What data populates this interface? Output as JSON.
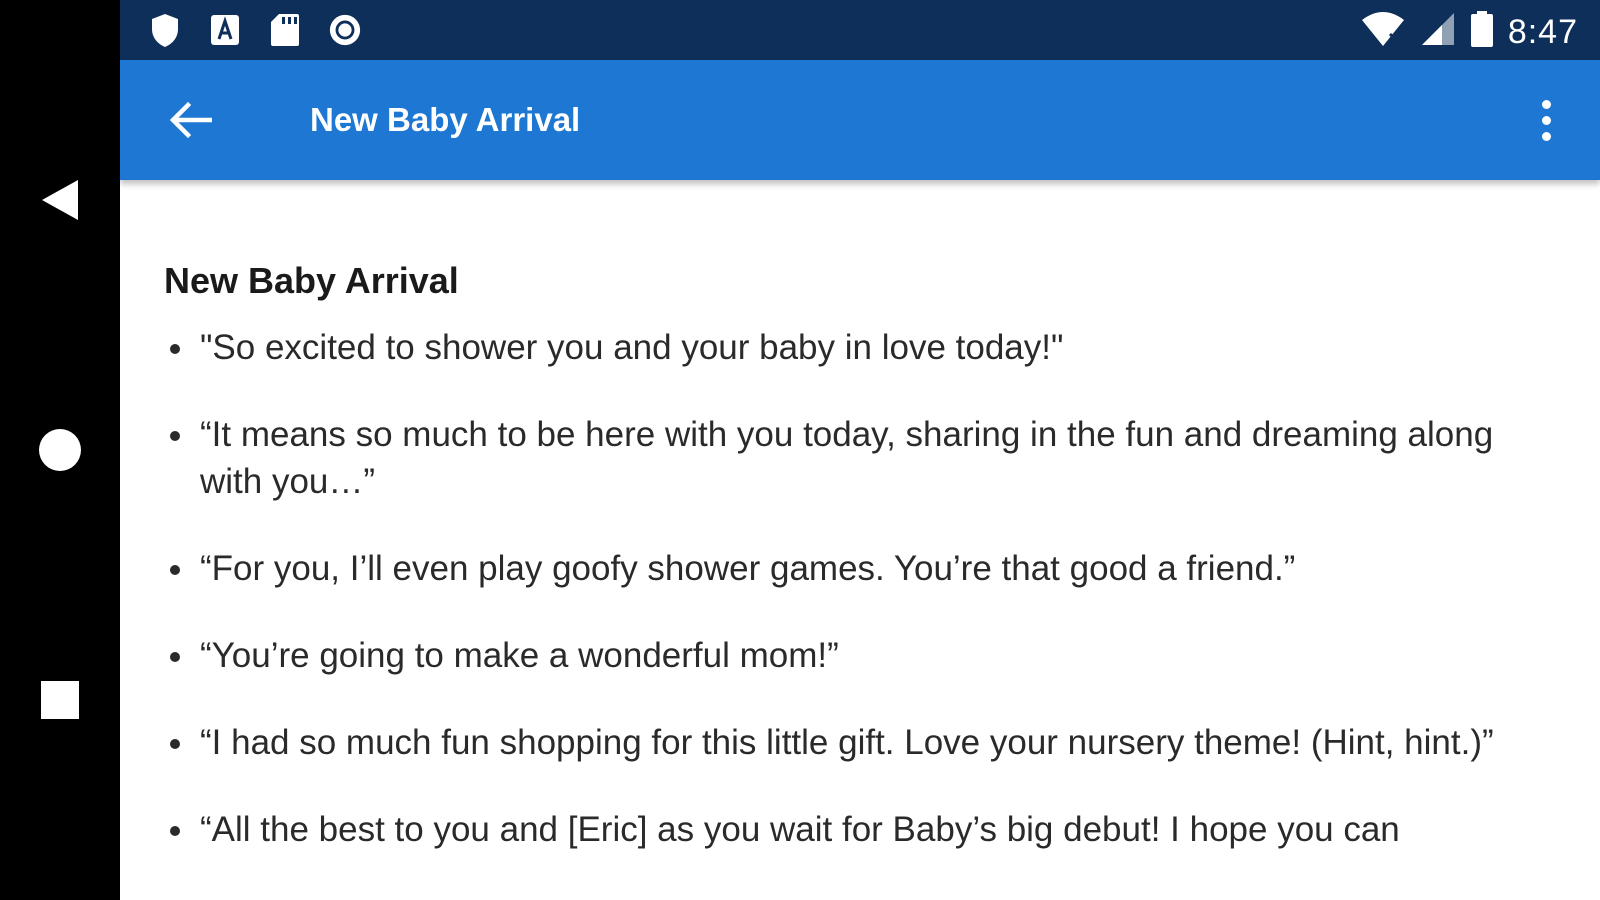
{
  "statusbar": {
    "time": "8:47",
    "icons_left": [
      "shield-icon",
      "font-a-icon",
      "sd-card-icon",
      "record-circle-icon"
    ],
    "icons_right": [
      "wifi-icon",
      "cell-signal-icon",
      "battery-icon"
    ]
  },
  "appbar": {
    "title": "New Baby Arrival",
    "back_icon": "arrow-left-icon",
    "menu_icon": "more-vert-icon"
  },
  "content": {
    "title": "New Baby Arrival",
    "quotes": [
      "\"So excited to shower you and your baby in love today!\"",
      "“It means so much to be here with you today, sharing in the fun and dreaming along with you…”",
      "“For you, I’ll even play goofy shower games. You’re that good a friend.”",
      "“You’re going to make a wonderful mom!”",
      "“I had so much fun shopping for this little gift. Love your nursery theme! (Hint, hint.)”",
      "“All the best to you and [Eric] as you wait for Baby’s big debut! I hope you can"
    ]
  },
  "navbar": {
    "buttons": [
      "back-triangle-icon",
      "home-circle-icon",
      "recents-square-icon"
    ]
  },
  "colors": {
    "statusbar": "#0d2f5a",
    "appbar": "#1e77d2",
    "background": "#ffffff",
    "text": "#2a2a2a"
  }
}
